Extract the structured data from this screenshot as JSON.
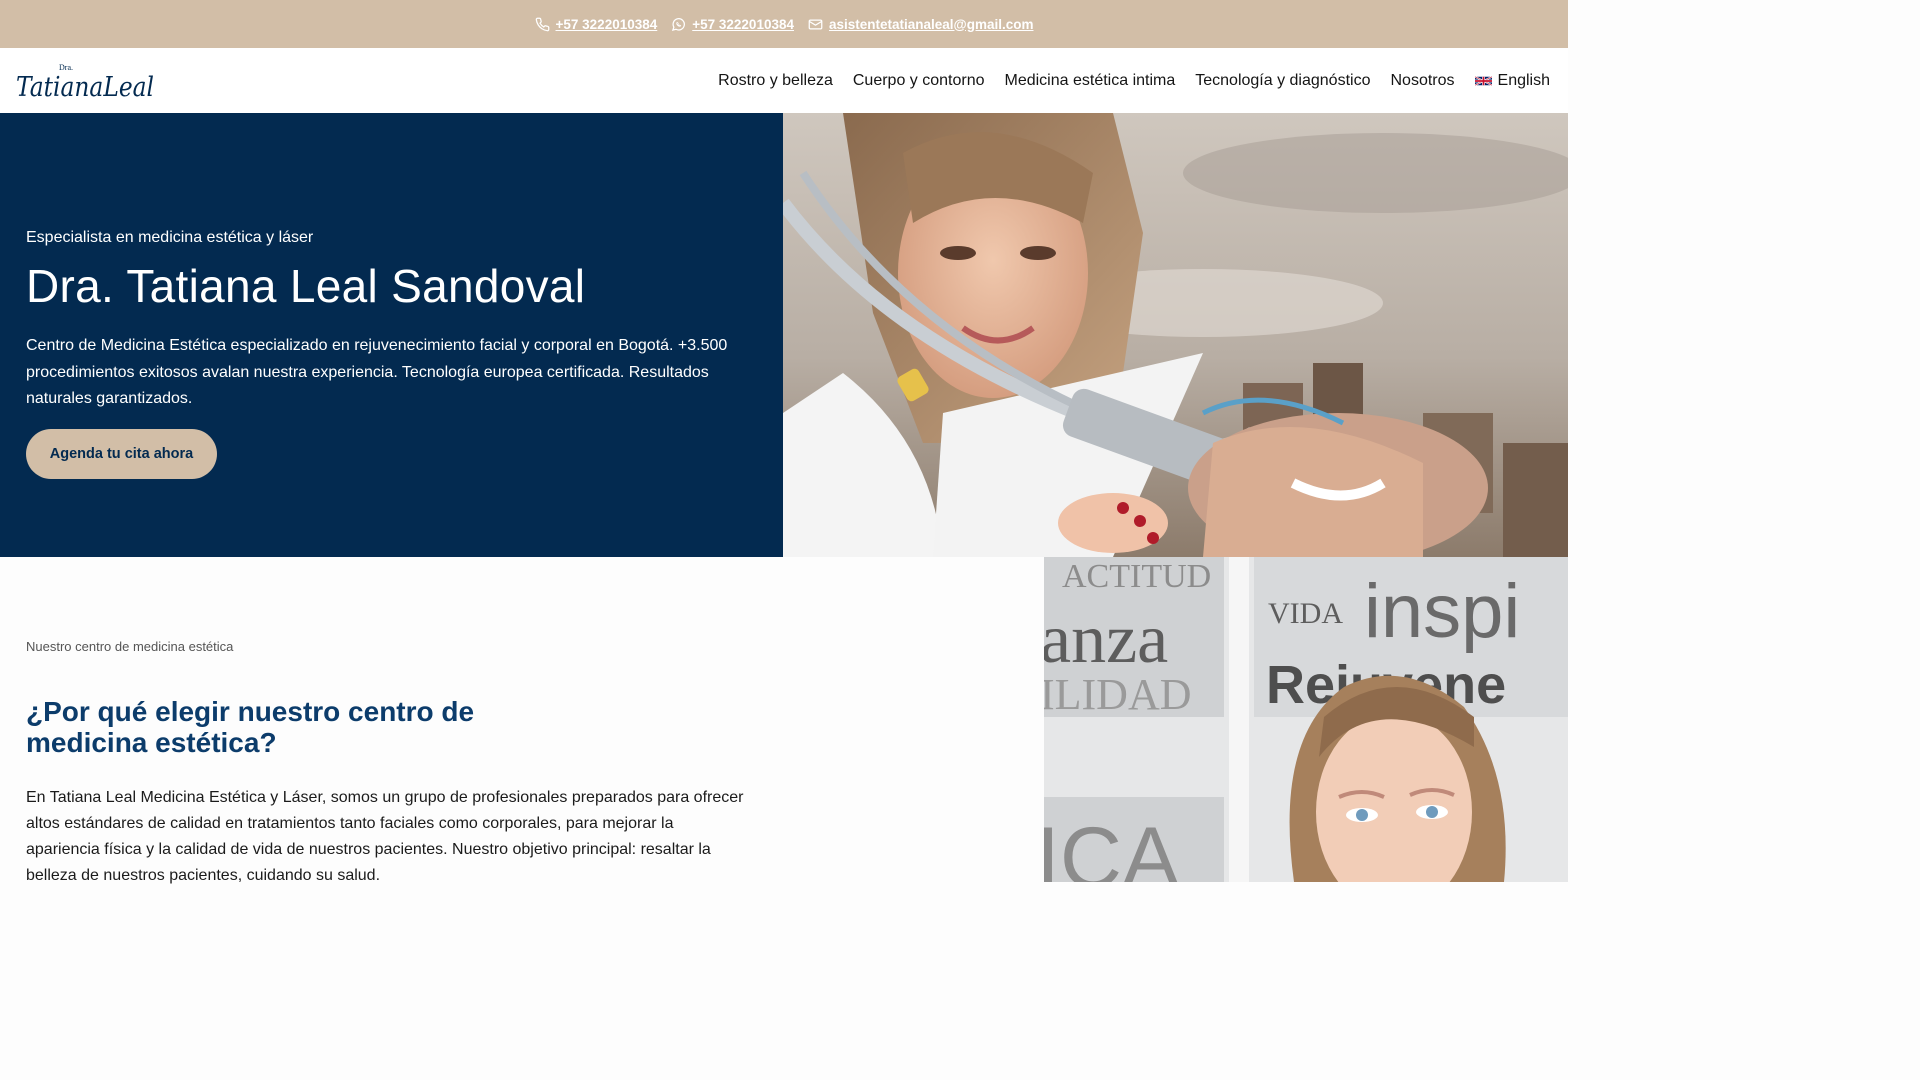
{
  "topbar": {
    "phone": "+57 3222010384",
    "whatsapp": "+57 3222010384",
    "email": "asistentetatianaleal@gmail.com",
    "bg_color": "#d2bea7"
  },
  "logo": {
    "prefix": "Dra.",
    "name": "TatianaLeal"
  },
  "nav": {
    "items": [
      "Rostro y belleza",
      "Cuerpo y contorno",
      "Medicina estética intima",
      "Tecnología y diagnóstico",
      "Nosotros"
    ],
    "language": "English"
  },
  "hero": {
    "eyebrow": "Especialista en medicina estética y láser",
    "title": "Dra. Tatiana Leal Sandoval",
    "description": "Centro de Medicina Estética especializado en rejuvenecimiento facial y corporal en Bogotá. +3.500 procedimientos exitosos avalan nuestra experiencia. Tecnología europea certificada. Resultados naturales garantizados.",
    "cta": "Agenda tu cita ahora",
    "bg_color": "#032a50",
    "accent_color": "#d2bea7"
  },
  "about": {
    "eyebrow": "Nuestro centro de medicina estética",
    "title": "¿Por qué elegir nuestro centro de medicina estética?",
    "text": "En Tatiana Leal Medicina Estética y Láser, somos un grupo de profesionales preparados para ofrecer altos estándares de calidad en tratamientos tanto faciales como corporales, para mejorar la apariencia física y la calidad de vida de nuestros pacientes. Nuestro objetivo principal: resaltar la belleza de nuestros pacientes, cuidando su salud.",
    "title_color": "#0c3c6b",
    "wall_words": [
      "ACTITUD",
      "anza",
      "ILIDAD",
      "VIDA",
      "inspi",
      "Rejuvene",
      "ICA"
    ]
  }
}
